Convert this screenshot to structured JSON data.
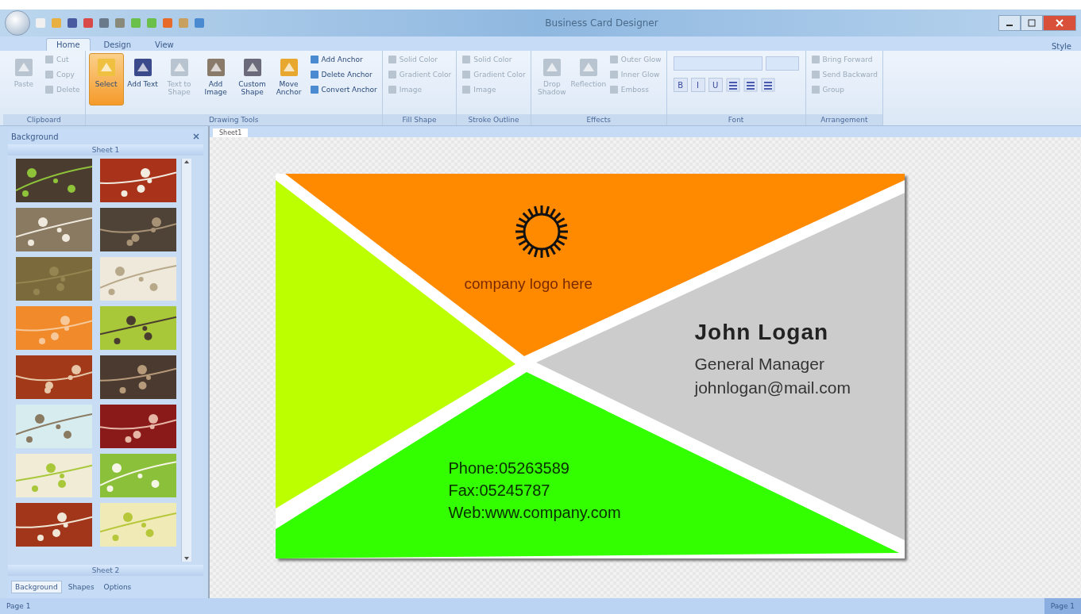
{
  "window": {
    "title": "Business Card Designer"
  },
  "ribbon": {
    "tabs": [
      {
        "label": "Home",
        "selected": true
      },
      {
        "label": "Design",
        "selected": false
      },
      {
        "label": "View",
        "selected": false
      }
    ],
    "groups": [
      {
        "label": "Clipboard",
        "buttons": [
          {
            "label": "Paste",
            "kind": "large",
            "disabled": true,
            "selected": false
          },
          {
            "label": "Cut",
            "kind": "small",
            "disabled": true,
            "selected": false
          },
          {
            "label": "Copy",
            "kind": "small",
            "disabled": true,
            "selected": false
          },
          {
            "label": "Delete",
            "kind": "small",
            "disabled": true,
            "selected": false
          }
        ]
      },
      {
        "label": "Drawing Tools",
        "buttons": [
          {
            "label": "Select",
            "kind": "large",
            "disabled": false,
            "selected": true
          },
          {
            "label": "Add Text",
            "kind": "large",
            "disabled": false,
            "selected": false
          },
          {
            "label": "Text to Shape",
            "kind": "large",
            "disabled": true,
            "selected": false
          },
          {
            "label": "Add Image",
            "kind": "large",
            "disabled": false,
            "selected": false
          },
          {
            "label": "Custom Shape",
            "kind": "large",
            "disabled": false,
            "selected": false
          },
          {
            "label": "Move Anchor",
            "kind": "large",
            "disabled": false,
            "selected": false
          },
          {
            "label": "Add Anchor",
            "kind": "small",
            "disabled": false,
            "selected": false
          },
          {
            "label": "Delete Anchor",
            "kind": "small",
            "disabled": false,
            "selected": false
          },
          {
            "label": "Convert Anchor",
            "kind": "small",
            "disabled": false,
            "selected": false
          }
        ]
      },
      {
        "label": "Fill Shape",
        "buttons": [
          {
            "label": "Solid Color",
            "kind": "small",
            "disabled": true,
            "selected": false
          },
          {
            "label": "Gradient Color",
            "kind": "small",
            "disabled": true,
            "selected": false
          },
          {
            "label": "Image",
            "kind": "small",
            "disabled": true,
            "selected": false
          }
        ]
      },
      {
        "label": "Stroke Outline",
        "buttons": [
          {
            "label": "Solid Color",
            "kind": "small",
            "disabled": true,
            "selected": false
          },
          {
            "label": "Gradient Color",
            "kind": "small",
            "disabled": true,
            "selected": false
          },
          {
            "label": "Image",
            "kind": "small",
            "disabled": true,
            "selected": false
          }
        ]
      },
      {
        "label": "Effects",
        "buttons": [
          {
            "label": "Drop Shadow",
            "kind": "large",
            "disabled": true,
            "selected": false
          },
          {
            "label": "Reflection",
            "kind": "large",
            "disabled": true,
            "selected": false
          },
          {
            "label": "Outer Glow",
            "kind": "small",
            "disabled": true,
            "selected": false
          },
          {
            "label": "Inner Glow",
            "kind": "small",
            "disabled": true,
            "selected": false
          },
          {
            "label": "Emboss",
            "kind": "small",
            "disabled": true,
            "selected": false
          }
        ]
      },
      {
        "label": "Font",
        "buttons": [
          {
            "label": "B",
            "kind": "format",
            "disabled": false,
            "selected": false
          },
          {
            "label": "I",
            "kind": "format",
            "disabled": false,
            "selected": false
          },
          {
            "label": "U",
            "kind": "format",
            "disabled": false,
            "selected": false
          }
        ]
      },
      {
        "label": "Arrangement",
        "buttons": [
          {
            "label": "Bring Forward",
            "kind": "small",
            "disabled": true,
            "selected": false
          },
          {
            "label": "Send Backward",
            "kind": "small",
            "disabled": true,
            "selected": false
          },
          {
            "label": "Group",
            "kind": "small",
            "disabled": true,
            "selected": false
          }
        ]
      }
    ],
    "style_menu": "Style"
  },
  "panel": {
    "title": "Background",
    "section": "Sheet 1",
    "footer": "Sheet 2",
    "tabs": [
      {
        "label": "Background",
        "selected": true
      },
      {
        "label": "Shapes",
        "selected": false
      },
      {
        "label": "Options",
        "selected": false
      }
    ]
  },
  "document_tab": "Sheet1",
  "card": {
    "logo_text": "company logo here",
    "name": "John Logan",
    "job_title": "General Manager",
    "email": "johnlogan@mail.com",
    "phone": "Phone:05263589",
    "fax": "Fax:05245787",
    "web": "Web:www.company.com"
  },
  "status_bar": {
    "left": "Page 1",
    "right": "Page 1"
  }
}
